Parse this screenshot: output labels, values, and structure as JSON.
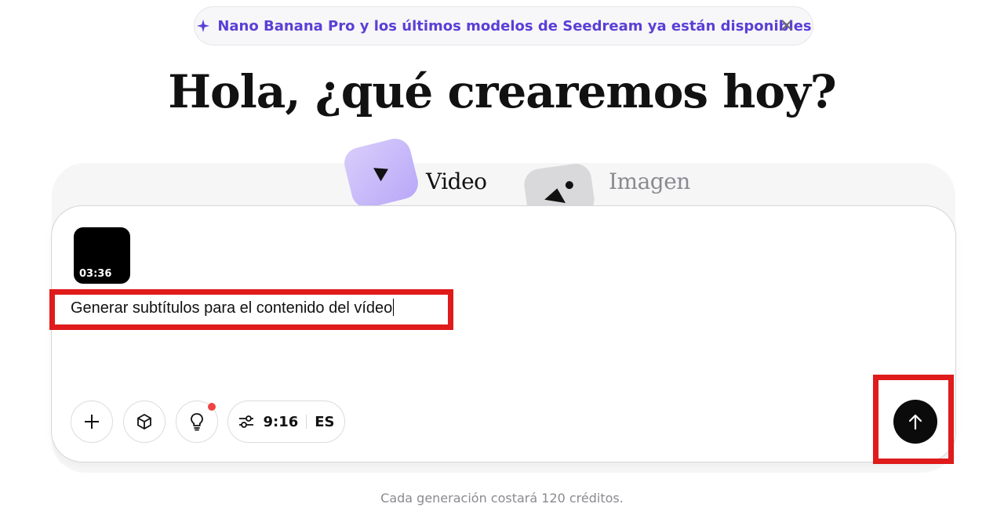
{
  "banner": {
    "text": "Nano Banana Pro y los últimos modelos de Seedream ya están disponibles",
    "icon": "sparkle-icon",
    "close_icon": "close-icon",
    "color": "#5b3fd6"
  },
  "heading": "Hola, ¿qué crearemos hoy?",
  "modes": [
    {
      "label": "Video",
      "icon": "play-icon",
      "active": true,
      "accent": "#b9a8f8"
    },
    {
      "label": "Imagen",
      "icon": "image-icon",
      "active": false
    }
  ],
  "composer": {
    "attachment": {
      "duration": "03:36"
    },
    "prompt": "Generar subtítulos para el contenido del vídeo",
    "tools": {
      "add_icon": "plus-icon",
      "model_icon": "cube-icon",
      "idea_icon": "lightbulb-icon",
      "settings_icon": "sliders-icon",
      "aspect_ratio": "9:16",
      "language": "ES"
    },
    "send_icon": "arrow-up-icon"
  },
  "footer": "Cada generación costará 120 créditos.",
  "colors": {
    "highlight": "#e01b1b",
    "send": "#0b0b0b",
    "notification": "#ef4444"
  }
}
